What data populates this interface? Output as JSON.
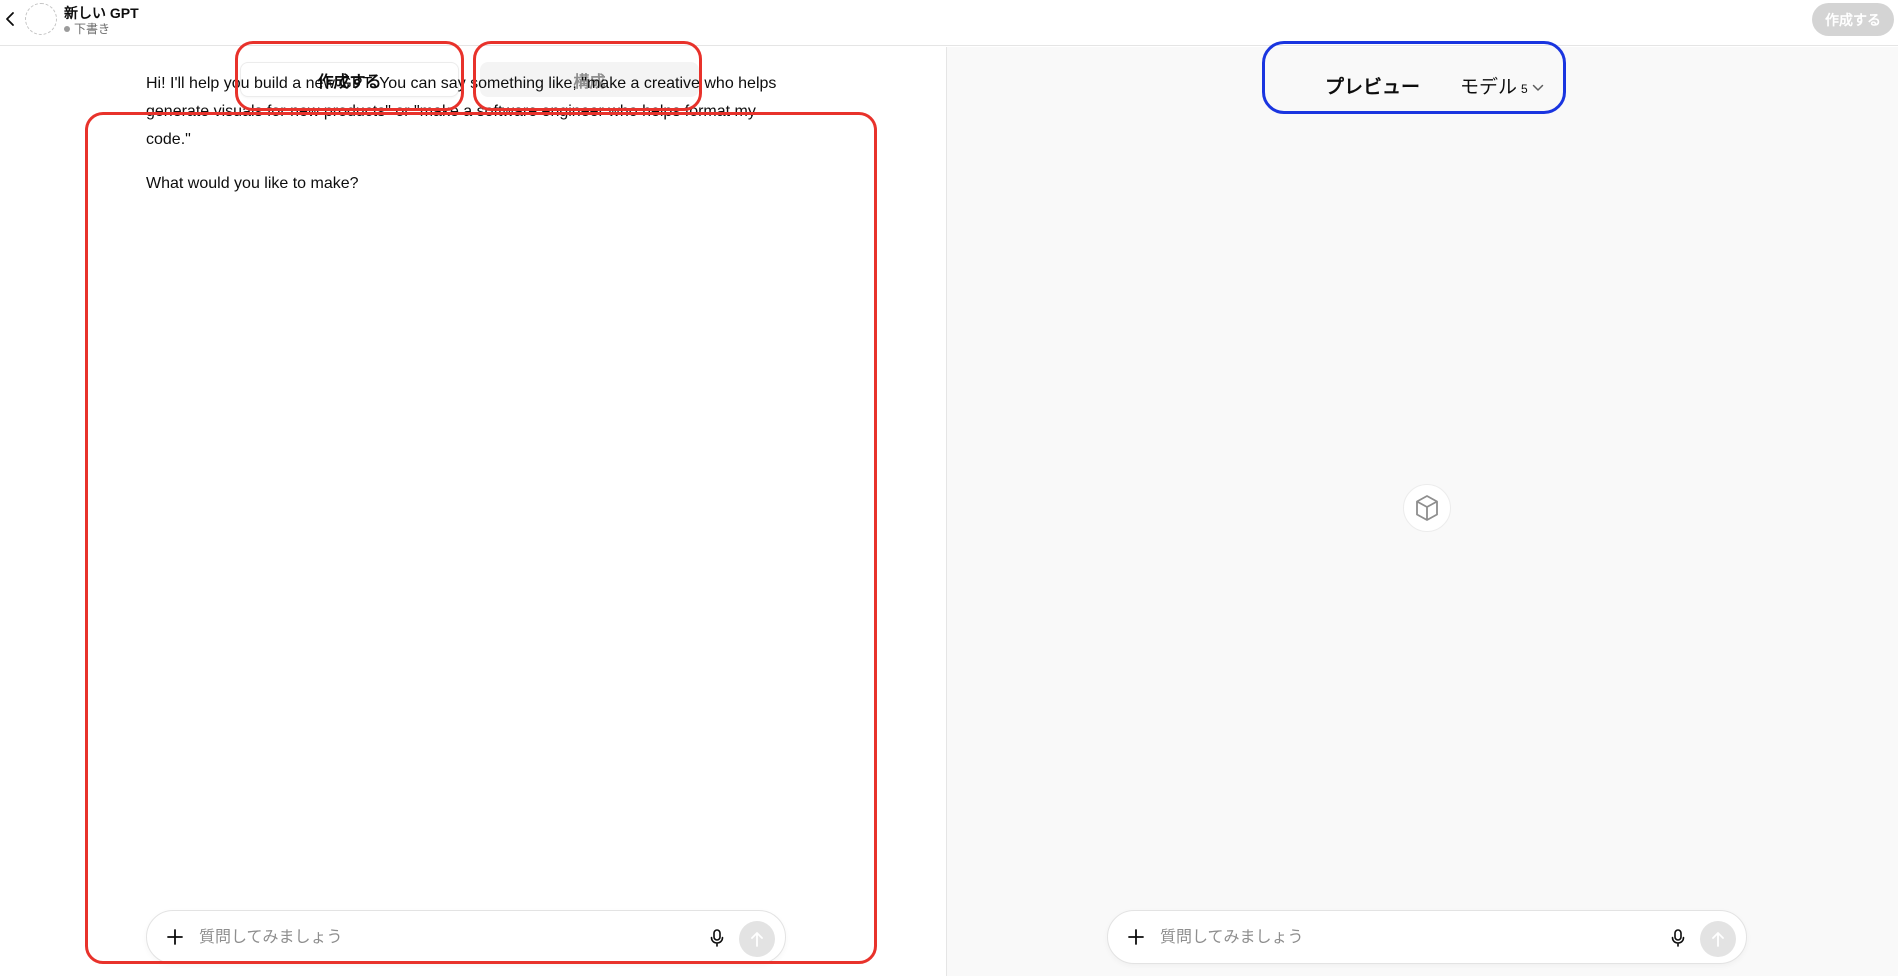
{
  "header": {
    "gpt_name": "新しい GPT",
    "status": "下書き",
    "create_button": "作成する"
  },
  "tabs": {
    "create": "作成する",
    "configure": "構成"
  },
  "messages": [
    "Hi! I'll help you build a new GPT. You can say something like, \"make a creative who helps generate visuals for new products\" or \"make a software engineer who helps format my code.\"",
    "What would you like to make?"
  ],
  "left_composer": {
    "placeholder": "質問してみましょう"
  },
  "preview": {
    "title": "プレビュー",
    "model_label": "モデル",
    "model_version": "5"
  },
  "right_composer": {
    "placeholder": "質問してみましょう"
  },
  "icons": {
    "back": "chevron-left-icon",
    "plus": "plus-icon",
    "mic": "microphone-icon",
    "send": "arrow-up-icon",
    "chevron": "chevron-down-icon",
    "center": "cube-icon"
  },
  "colors": {
    "highlight_red": "#e8322b",
    "highlight_blue": "#1a35e0",
    "preview_bg": "#f9f9f9"
  }
}
